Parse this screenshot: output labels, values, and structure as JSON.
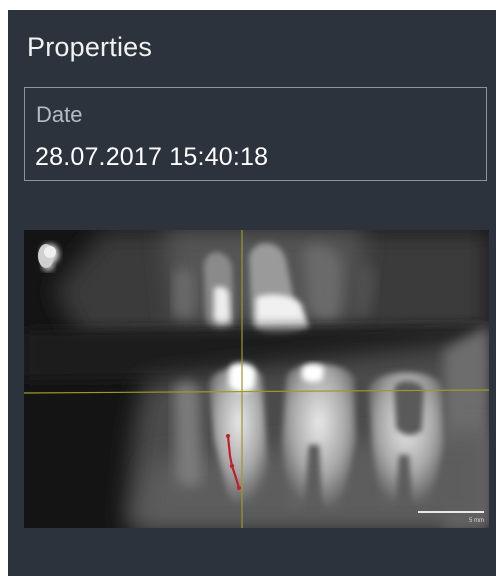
{
  "panel": {
    "title": "Properties"
  },
  "date_field": {
    "label": "Date",
    "value": "28.07.2017 15:40:18"
  },
  "preview": {
    "scale_label": "5 mm",
    "crosshair_color": "#9a9a2a",
    "annotation_color": "#c0202a",
    "orientation_icon": "skull-orientation-icon"
  },
  "colors": {
    "panel_background": "#2c333d",
    "text_primary": "#f2f2f2",
    "text_secondary": "#b7bcc2",
    "border": "#8b939d"
  }
}
